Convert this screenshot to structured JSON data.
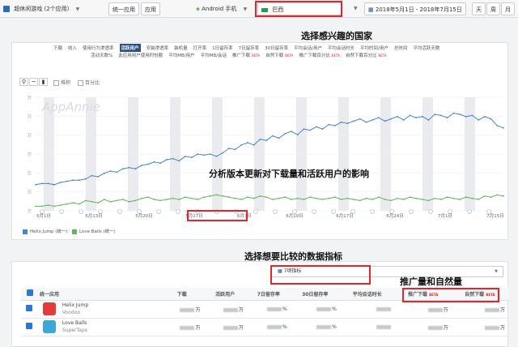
{
  "topbar": {
    "category": "超休闲游戏 (2个应用)",
    "compare_mode": "统一应用",
    "app_button": "应用",
    "device": "Android 手机",
    "country": "巴西",
    "date_range": "2018年5月1日 - 2018年7月15日",
    "granularity": [
      "天",
      "周",
      "月"
    ]
  },
  "annotations": {
    "country": "选择感兴趣的国家",
    "version_impact": "分析版本更新对下载量和活跃用户的影响",
    "compare_metrics": "选择想要比较的数据指标",
    "paid_organic": "推广量和自然量"
  },
  "metrics": {
    "row1": [
      {
        "label": "下载",
        "active": false
      },
      {
        "label": "收入",
        "active": false
      },
      {
        "label": "使用行为渗透率",
        "active": false
      },
      {
        "label": "活跃用户",
        "active": true
      },
      {
        "label": "安装渗透率",
        "active": false
      },
      {
        "label": "装机量",
        "active": false
      },
      {
        "label": "打开率",
        "active": false
      },
      {
        "label": "1日留存率",
        "active": false
      },
      {
        "label": "7日留存率",
        "active": false
      },
      {
        "label": "30日留存率",
        "active": false
      },
      {
        "label": "平均会话/用户",
        "active": false
      },
      {
        "label": "平均会话时长",
        "active": false
      },
      {
        "label": "平均时间/用户",
        "active": false
      },
      {
        "label": "总时间",
        "active": false
      },
      {
        "label": "平均活跃天数",
        "active": false
      }
    ],
    "row2": [
      {
        "label": "活动天数%",
        "beta": false
      },
      {
        "label": "此应用用户使用时份额",
        "beta": false
      },
      {
        "label": "平均MB/用户",
        "beta": false
      },
      {
        "label": "平均MB/会话",
        "beta": false
      },
      {
        "label": "推广下载",
        "beta": true
      },
      {
        "label": "自然下载",
        "beta": true
      },
      {
        "label": "推广下载百分比",
        "beta": true
      },
      {
        "label": "自然下载百分比",
        "beta": true
      }
    ],
    "beta_label": "BETA"
  },
  "chart_toolbar": {
    "stacked": "堆积",
    "percent": "百分比"
  },
  "chart_data": {
    "type": "line",
    "watermark": "AppAnnie",
    "y_tick_suffix": "万",
    "x_ticks": [
      "5月1日",
      "5月13日",
      "5月20日",
      "5月27日",
      "6月3日",
      "6月10日",
      "6月17日",
      "6月24日",
      "7月1日",
      "7月15日"
    ],
    "series": [
      {
        "name": "Helix Jump (统一)",
        "color": "#4a86c5",
        "values": [
          0.23,
          0.24,
          0.24,
          0.23,
          0.25,
          0.26,
          0.27,
          0.27,
          0.28,
          0.31,
          0.3,
          0.33,
          0.35,
          0.34,
          0.37,
          0.38,
          0.37,
          0.4,
          0.41,
          0.43,
          0.42,
          0.45,
          0.46,
          0.44,
          0.48,
          0.47,
          0.5,
          0.49,
          0.5,
          0.48,
          0.51,
          0.55,
          0.54,
          0.58,
          0.6,
          0.58,
          0.63,
          0.62,
          0.66,
          0.64,
          0.68,
          0.7,
          0.67,
          0.72,
          0.71,
          0.74,
          0.72,
          0.76,
          0.75,
          0.78,
          0.77,
          0.79,
          0.81,
          0.78,
          0.8,
          0.82,
          0.79,
          0.81,
          0.83,
          0.8,
          0.84,
          0.82,
          0.83,
          0.8,
          0.85,
          0.84,
          0.82,
          0.86,
          0.85,
          0.83,
          0.84,
          0.8,
          0.83,
          0.81,
          0.75,
          0.73
        ]
      },
      {
        "name": "Love Balls (统一)",
        "color": "#5fb85c",
        "values": [
          0.04,
          0.04,
          0.05,
          0.04,
          0.05,
          0.06,
          0.07,
          0.06,
          0.09,
          0.08,
          0.07,
          0.1,
          0.08,
          0.09,
          0.1,
          0.08,
          0.09,
          0.11,
          0.12,
          0.1,
          0.09,
          0.1,
          0.11,
          0.1,
          0.12,
          0.11,
          0.1,
          0.12,
          0.13,
          0.14,
          0.13,
          0.12,
          0.11,
          0.1,
          0.12,
          0.11,
          0.13,
          0.12,
          0.1,
          0.11,
          0.12,
          0.1,
          0.11,
          0.1,
          0.12,
          0.11,
          0.1,
          0.11,
          0.12,
          0.1,
          0.11,
          0.1,
          0.09,
          0.11,
          0.1,
          0.12,
          0.1,
          0.09,
          0.11,
          0.1,
          0.12,
          0.11,
          0.1,
          0.09,
          0.11,
          0.1,
          0.12,
          0.11,
          0.1,
          0.12,
          0.11,
          0.1,
          0.13,
          0.12,
          0.14,
          0.13
        ]
      }
    ],
    "grid": true,
    "legend_position": "bottom-left"
  },
  "metric_select": {
    "label": "7项指标"
  },
  "table": {
    "columns": [
      "统一应用",
      "下载",
      "活跃用户",
      "7日留存率",
      "30日留存率",
      "平均会话时长",
      "推广下载",
      "自然下载"
    ],
    "rows": [
      {
        "app": "Helix Jump",
        "publisher": "Voodoo",
        "icon_color": "#e23b3b",
        "values": [
          "万",
          "万",
          "%",
          "%",
          "",
          "万",
          "万"
        ]
      },
      {
        "app": "Love Balls",
        "publisher": "SuperTapx",
        "icon_color": "#3ca7d9",
        "values": [
          "万",
          "万",
          "%",
          "%",
          "",
          "万",
          "万"
        ]
      }
    ]
  }
}
